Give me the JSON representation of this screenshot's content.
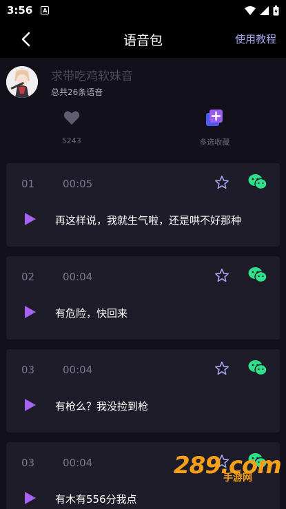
{
  "status": {
    "time": "3:56",
    "notif_letter": "A"
  },
  "header": {
    "title": "语音包",
    "tutorial": "使用教程"
  },
  "profile": {
    "name": "求带吃鸡软妹音",
    "count_text": "总共26条语音"
  },
  "actions": {
    "like_count": "5243",
    "multi_select_label": "多选收藏"
  },
  "colors": {
    "accent": "#a4a2ea",
    "play": "#a662f0",
    "wechat": "#2fe08a",
    "card": "#1e1c29"
  },
  "items": [
    {
      "num": "01",
      "duration": "00:05",
      "text": "再这样说，我就生气啦，还是哄不好那种"
    },
    {
      "num": "02",
      "duration": "00:04",
      "text": "有危险，快回来"
    },
    {
      "num": "03",
      "duration": "00:04",
      "text": "有枪么？我没捡到枪"
    },
    {
      "num": "03",
      "duration": "00:04",
      "text": "有木有556分我点"
    }
  ],
  "watermark": {
    "main": "289.com",
    "sub": "手游网"
  }
}
